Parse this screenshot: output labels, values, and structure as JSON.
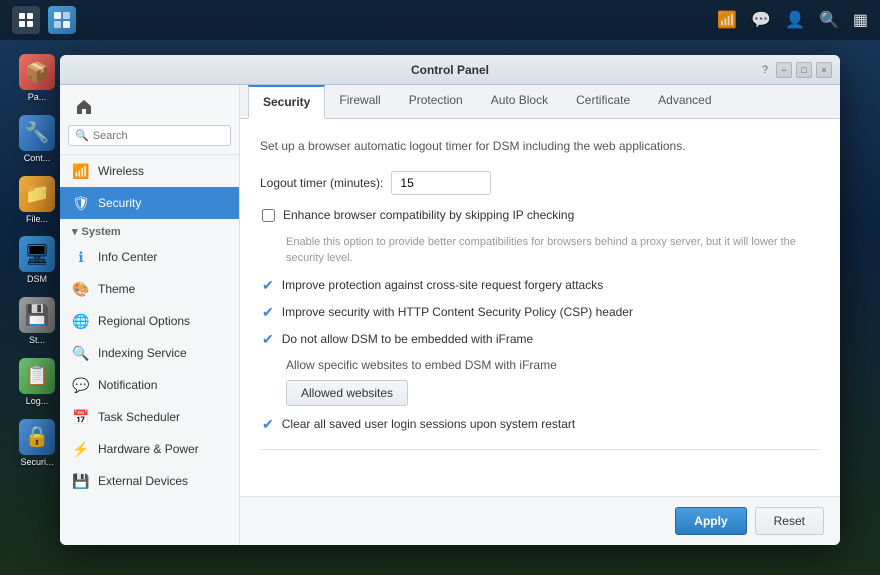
{
  "taskbar": {
    "app_label": "Control Panel",
    "icons": [
      "⊹",
      "💬",
      "👤",
      "🔍",
      "▦"
    ]
  },
  "desktop_icons": [
    {
      "id": "packages",
      "label": "Pa...",
      "color": "#e04040",
      "emoji": "📦"
    },
    {
      "id": "control",
      "label": "Cont...",
      "color": "#3a87d4",
      "emoji": "🔧"
    },
    {
      "id": "file",
      "label": "File...",
      "color": "#f0a030",
      "emoji": "📁"
    },
    {
      "id": "dsm",
      "label": "DSM",
      "color": "#2080c0",
      "emoji": "🖥"
    },
    {
      "id": "storage",
      "label": "St... Ma...",
      "color": "#909090",
      "emoji": "💾"
    },
    {
      "id": "log",
      "label": "Log...",
      "color": "#60a060",
      "emoji": "📋"
    },
    {
      "id": "security",
      "label": "Securi...",
      "color": "#3a87d4",
      "emoji": "🔒"
    }
  ],
  "window": {
    "title": "Control Panel"
  },
  "window_controls": {
    "help": "?",
    "minimize": "−",
    "maximize": "□",
    "close": "×"
  },
  "sidebar": {
    "search_placeholder": "Search",
    "items": [
      {
        "id": "wireless",
        "label": "Wireless",
        "icon": "📶",
        "type": "item"
      },
      {
        "id": "security",
        "label": "Security",
        "icon": "🛡",
        "type": "item",
        "active": true
      },
      {
        "id": "system-section",
        "label": "System",
        "type": "section"
      },
      {
        "id": "info-center",
        "label": "Info Center",
        "icon": "ℹ",
        "type": "item"
      },
      {
        "id": "theme",
        "label": "Theme",
        "icon": "🎨",
        "type": "item"
      },
      {
        "id": "regional-options",
        "label": "Regional Options",
        "icon": "🌐",
        "type": "item"
      },
      {
        "id": "indexing-service",
        "label": "Indexing Service",
        "icon": "🔍",
        "type": "item"
      },
      {
        "id": "notification",
        "label": "Notification",
        "icon": "💬",
        "type": "item"
      },
      {
        "id": "task-scheduler",
        "label": "Task Scheduler",
        "icon": "📅",
        "type": "item"
      },
      {
        "id": "hardware-power",
        "label": "Hardware & Power",
        "icon": "⚡",
        "type": "item"
      },
      {
        "id": "external-devices",
        "label": "External Devices",
        "icon": "💾",
        "type": "item"
      }
    ]
  },
  "tabs": [
    {
      "id": "security",
      "label": "Security",
      "active": true
    },
    {
      "id": "firewall",
      "label": "Firewall",
      "active": false
    },
    {
      "id": "protection",
      "label": "Protection",
      "active": false
    },
    {
      "id": "auto-block",
      "label": "Auto Block",
      "active": false
    },
    {
      "id": "certificate",
      "label": "Certificate",
      "active": false
    },
    {
      "id": "advanced",
      "label": "Advanced",
      "active": false
    }
  ],
  "content": {
    "description": "Set up a browser automatic logout timer for DSM including the web applications.",
    "logout_label": "Logout timer (minutes):",
    "logout_value": "15",
    "options": [
      {
        "id": "ip-checking",
        "checked": false,
        "label": "Enhance browser compatibility by skipping IP checking",
        "info": "Enable this option to provide better compatibilities for browsers behind a proxy server, but it will lower the security level.",
        "has_info": true
      },
      {
        "id": "csrf",
        "checked": true,
        "label": "Improve protection against cross-site request forgery attacks",
        "has_info": false
      },
      {
        "id": "csp",
        "checked": true,
        "label": "Improve security with HTTP Content Security Policy (CSP) header",
        "has_info": false
      },
      {
        "id": "iframe",
        "checked": true,
        "label": "Do not allow DSM to be embedded with iFrame",
        "has_info": false,
        "has_sub": true,
        "sub_label": "Allow specific websites to embed DSM with iFrame",
        "sub_btn": "Allowed websites"
      }
    ],
    "last_option": {
      "id": "clear-sessions",
      "checked": true,
      "label": "Clear all saved user login sessions upon system restart"
    }
  },
  "footer": {
    "apply_label": "Apply",
    "reset_label": "Reset"
  }
}
